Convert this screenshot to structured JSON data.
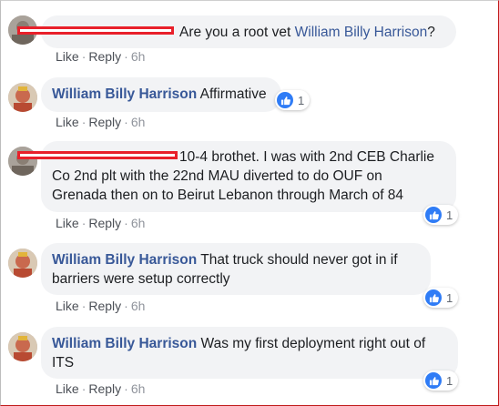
{
  "colors": {
    "name": "#385898",
    "redaction": "#e8202a",
    "like_blue": "#2f7cf6",
    "bubble_bg": "#f2f3f5",
    "meta": "#90949c"
  },
  "comments": [
    {
      "author": "",
      "author_redacted": true,
      "text": "Are you a root vet ",
      "mention": "William Billy Harrison",
      "suffix": "?",
      "actions": {
        "like": "Like",
        "reply": "Reply",
        "time": "6h"
      },
      "reactions": null
    },
    {
      "author": "William Billy Harrison",
      "author_redacted": false,
      "text": "Affirmative",
      "actions": {
        "like": "Like",
        "reply": "Reply",
        "time": "6h"
      },
      "reactions": {
        "icon": "like-icon",
        "count": "1"
      }
    },
    {
      "author": "",
      "author_redacted": true,
      "text_line1": "10-4 brothet. I was with 2nd CEB Charlie",
      "text_line2": "Co 2nd plt with the 22nd MAU diverted to do OUF on",
      "text_line3": "Grenada then on to Beirut Lebanon through March of 84",
      "actions": {
        "like": "Like",
        "reply": "Reply",
        "time": "6h"
      },
      "reactions": {
        "icon": "like-icon",
        "count": "1"
      }
    },
    {
      "author": "William Billy Harrison",
      "author_redacted": false,
      "text_line1": "That truck should never got in if",
      "text_line2": "barriers were setup correctly",
      "actions": {
        "like": "Like",
        "reply": "Reply",
        "time": "6h"
      },
      "reactions": {
        "icon": "like-icon",
        "count": "1"
      }
    },
    {
      "author": "William Billy Harrison",
      "author_redacted": false,
      "text_line1": "Was my first deployment right out of",
      "text_line2": "ITS",
      "actions": {
        "like": "Like",
        "reply": "Reply",
        "time": "6h"
      },
      "reactions": {
        "icon": "like-icon",
        "count": "1"
      }
    }
  ]
}
